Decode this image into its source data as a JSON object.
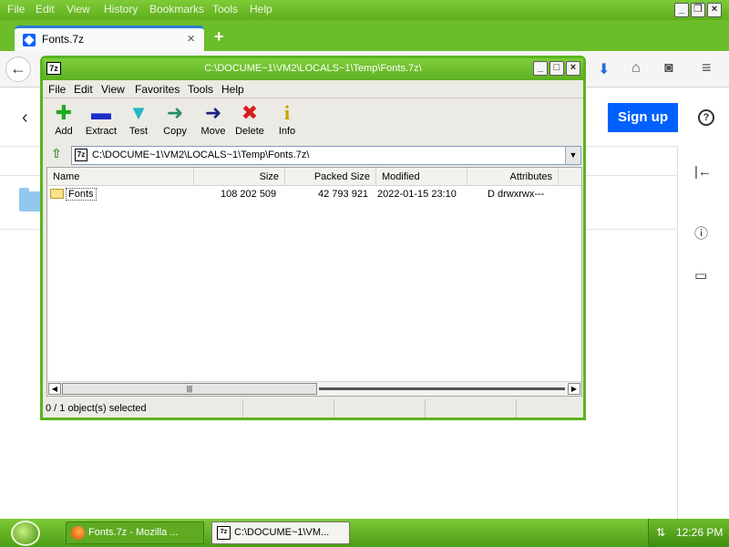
{
  "firefox": {
    "menu": [
      "File",
      "Edit",
      "View",
      "History",
      "Bookmarks",
      "Tools",
      "Help"
    ],
    "tab_title": "Fonts.7z",
    "tab_close": "×",
    "new_tab": "+",
    "back": "←"
  },
  "page": {
    "signup_label": "Sign up",
    "help_glyph": "?",
    "back_glyph": "‹",
    "collapse_glyph": "|←",
    "info_glyph": "ⓘ",
    "comment_glyph": "▭"
  },
  "sevenzip": {
    "title": "C:\\DOCUME~1\\VM2\\LOCALS~1\\Temp\\Fonts.7z\\",
    "app_icon_text": "7z",
    "menu": [
      "File",
      "Edit",
      "View",
      "Favorites",
      "Tools",
      "Help"
    ],
    "toolbar": [
      {
        "label": "Add",
        "glyph": "✚",
        "color": "#1faa1f"
      },
      {
        "label": "Extract",
        "glyph": "▬",
        "color": "#1a2fc8"
      },
      {
        "label": "Test",
        "glyph": "▼",
        "color": "#22b8c8"
      },
      {
        "label": "Copy",
        "glyph": "➜",
        "color": "#2a8f6a"
      },
      {
        "label": "Move",
        "glyph": "➜",
        "color": "#1a237e"
      },
      {
        "label": "Delete",
        "glyph": "✖",
        "color": "#d91c1c"
      },
      {
        "label": "Info",
        "glyph": "i",
        "color": "#c9a200"
      }
    ],
    "address": "C:\\DOCUME~1\\VM2\\LOCALS~1\\Temp\\Fonts.7z\\",
    "columns": {
      "name": "Name",
      "size": "Size",
      "packed": "Packed Size",
      "modified": "Modified",
      "attributes": "Attributes"
    },
    "rows": [
      {
        "name": "Fonts",
        "size": "108 202 509",
        "packed": "42 793 921",
        "modified": "2022-01-15 23:10",
        "attributes": "D drwxrwx---"
      }
    ],
    "status": "0 / 1 object(s) selected"
  },
  "taskbar": {
    "items": [
      {
        "label": "Fonts.7z - Mozilla ..."
      },
      {
        "label": "C:\\DOCUME~1\\VM..."
      }
    ],
    "clock": "12:26 PM"
  }
}
